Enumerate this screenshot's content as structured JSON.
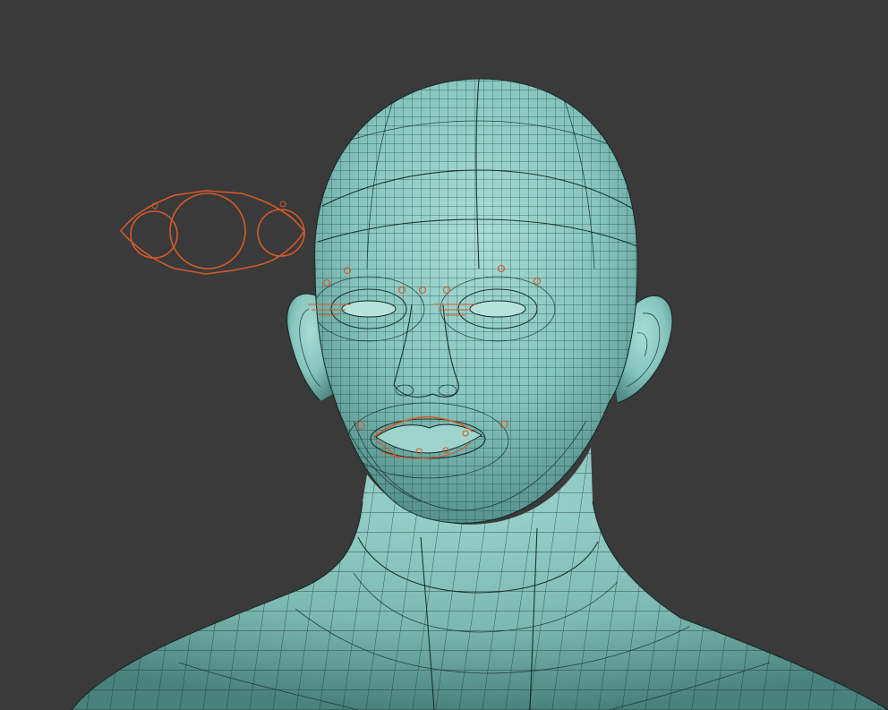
{
  "viewport": {
    "background_color": "#3a3a3a",
    "mesh_color": "#86c5bd",
    "wire_color": "#153230",
    "rig_color": "#d35a2a"
  },
  "scene": {
    "subject": "head-and-shoulders-wireframe-mesh",
    "rig_widget": "face-control-widget-icon"
  }
}
